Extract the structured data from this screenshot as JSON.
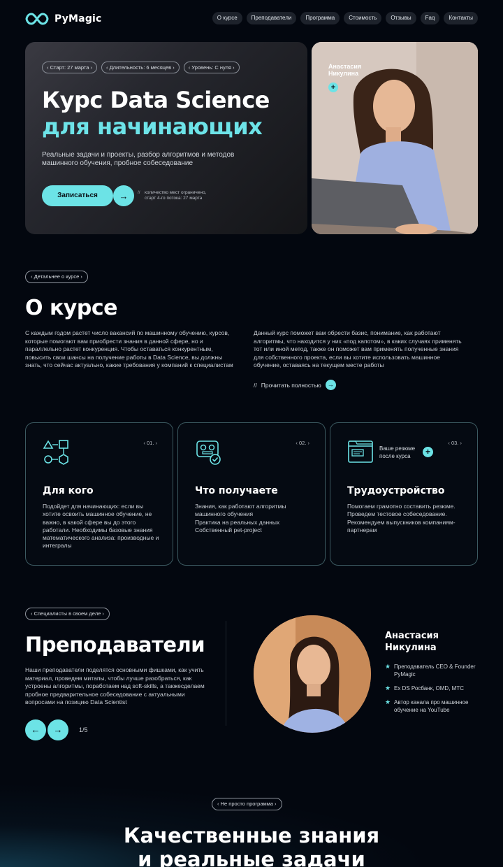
{
  "brand": {
    "name": "PyMagic",
    "icon": "infinity-icon",
    "accent": "#6ce3e6"
  },
  "nav": [
    "О курсе",
    "Преподаватели",
    "Программа",
    "Стоимость",
    "Отзывы",
    "Faq",
    "Контакты"
  ],
  "hero": {
    "chips": [
      "‹ Старт: 27 марта ›",
      "‹ Длительность: 6 месяцев ›",
      "‹ Уровень: С нуля ›"
    ],
    "title": "Курс Data Science",
    "title_accent": "для начинающих",
    "subtitle": "Реальные задачи и проекты, разбор алгоритмов и методов машинного обучения, пробное собеседование",
    "cta_label": "Записаться",
    "note_line1": "количество мест ограничено,",
    "note_line2": "старт 4-го потока: 27 марта",
    "teacher_first": "Анастасия",
    "teacher_last": "Никулина"
  },
  "about": {
    "tag": "‹ Детальнее о курсе ›",
    "title": "О курсе",
    "left_text": "С каждым годом растет число вакансий по машинному обучению, курсов, которые помогают вам приобрести знания в данной сфере, но и параллельно растет конкуренция. Чтобы оставаться конкурентным, повысить свои шансы на получение работы в Data Science, вы должны знать, что сейчас актуально, какие требования у компаний к специалистам",
    "right_text": "Данный курс поможет вам обрести базис, понимание, как работают алгоритмы, что находится у них «под капотом», в каких случаях применять тот или иной метод, также он поможет вам применять полученные знания для собственного проекта, если вы хотите использовать машинное обучение, оставаясь на текущем месте работы",
    "read_more": "Прочитать полностью"
  },
  "features": [
    {
      "num": "‹ 01. ›",
      "title": "Для кого",
      "icon": "shapes-flow-icon",
      "text": "Подойдет для начинающих: если вы хотите освоить машинное обучение, не важно, в какой сфере вы до этого работали. Необходимы базовые знания математического анализа: производные и интегралы"
    },
    {
      "num": "‹ 02. ›",
      "title": "Что получаете",
      "icon": "robot-check-icon",
      "text": "Знания, как работают алгоритмы машинного обучения\nПрактика на реальных данных\nСобственный pet-project"
    },
    {
      "num": "‹ 03. ›",
      "title": "Трудоустройство",
      "icon": "browser-window-icon",
      "resume_line1": "Ваше резюме",
      "resume_line2": "после курса",
      "text": "Помогаем грамотно составить резюме. Проведем тестовое собеседование. Рекомендуем выпускников компаниям-партнерам"
    }
  ],
  "teachers": {
    "tag": "‹ Специалисты в своем деле ›",
    "title": "Преподаватели",
    "text": "Наши преподаватели поделятся основными фишками, как учить материал, проведем митапы, чтобы лучше разобраться, как устроены алгоритмы, поработаем над soft-skills, а такжесделаем пробное предварительное собеседование с актуальными вопросами на позицию Data Scientist",
    "pager": "1/5",
    "name_first": "Анастасия",
    "name_last": "Никулина",
    "facts": [
      "Преподаватель CEO & Founder PyMagic",
      "Ex DS Росбанк, OMD, МТС",
      "Автор канала про машинное обучение на YouTube"
    ]
  },
  "program": {
    "tag": "‹ Не просто программа ›",
    "title_line1": "Качественные знания",
    "title_line2": "и реальные задачи"
  }
}
